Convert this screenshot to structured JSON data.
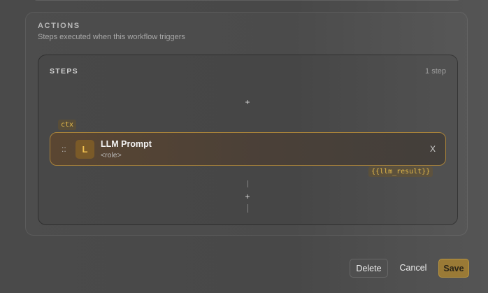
{
  "actions": {
    "title": "ACTIONS",
    "subtitle": "Steps executed when this workflow triggers"
  },
  "steps": {
    "title": "STEPS",
    "count": "1 step",
    "add_symbol": "+",
    "items": [
      {
        "input_tag": "ctx",
        "drag_handle": "::",
        "avatar": "L",
        "name": "LLM Prompt",
        "subtitle": "<role>",
        "remove": "X",
        "output_tag": "{{llm_result}}"
      }
    ]
  },
  "footer": {
    "delete_label": "Delete",
    "cancel_label": "Cancel",
    "save_label": "Save"
  },
  "colors": {
    "accent": "#e2b84a",
    "step_border": "#a8823a",
    "save_button": "#9a7a36"
  }
}
